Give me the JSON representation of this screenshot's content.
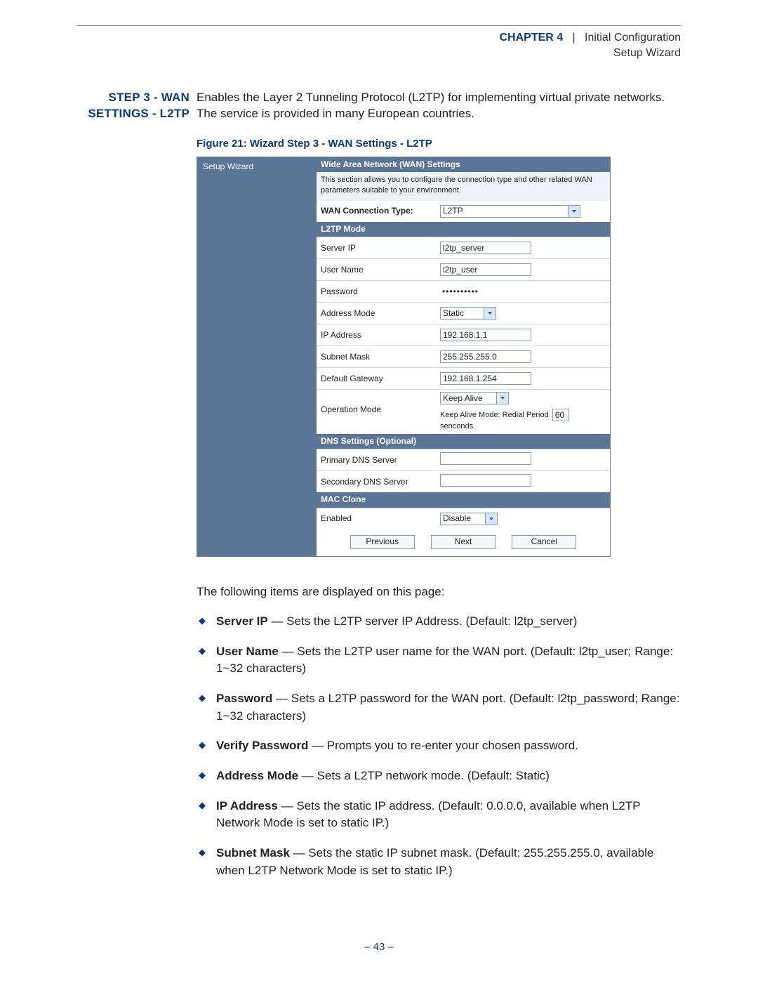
{
  "header": {
    "chapter_label": "CHAPTER",
    "chapter_no": "4",
    "separator": "|",
    "title": "Initial Configuration",
    "subtitle": "Setup Wizard"
  },
  "section": {
    "margin_title_line1": "STEP 3 - WAN",
    "margin_title_line2": "SETTINGS - L2TP",
    "intro": "Enables the Layer 2 Tunneling Protocol (L2TP) for implementing virtual private networks. The service is provided in many European countries."
  },
  "figure": {
    "caption": "Figure 21:  Wizard Step 3 - WAN Settings - L2TP",
    "sidebar_item": "Setup Wizard",
    "panel_title": "Wide Area Network (WAN) Settings",
    "panel_desc": "This section allows you to configure the connection type and other related WAN parameters suitable to your environment.",
    "conn_type_label": "WAN Connection Type:",
    "conn_type_value": "L2TP",
    "sections": {
      "l2tp_mode": "L2TP Mode",
      "dns": "DNS Settings (Optional)",
      "mac": "MAC Clone"
    },
    "rows": {
      "server_ip": {
        "label": "Server IP",
        "value": "l2tp_server"
      },
      "user_name": {
        "label": "User Name",
        "value": "l2tp_user"
      },
      "password": {
        "label": "Password",
        "value": "••••••••••"
      },
      "addr_mode": {
        "label": "Address Mode",
        "value": "Static"
      },
      "ip_address": {
        "label": "IP Address",
        "value": "192.168.1.1"
      },
      "subnet_mask": {
        "label": "Subnet Mask",
        "value": "255.255.255.0"
      },
      "gateway": {
        "label": "Default Gateway",
        "value": "192.168.1.254"
      },
      "op_mode": {
        "label": "Operation Mode",
        "value": "Keep Alive",
        "note_prefix": "Keep Alive Mode: Redial Period",
        "note_value": "60",
        "note_suffix": "senconds"
      },
      "pdns": {
        "label": "Primary DNS Server",
        "value": ""
      },
      "sdns": {
        "label": "Secondary DNS Server",
        "value": ""
      },
      "mac_enabled": {
        "label": "Enabled",
        "value": "Disable"
      }
    },
    "buttons": {
      "prev": "Previous",
      "next": "Next",
      "cancel": "Cancel"
    }
  },
  "after": {
    "lead": "The following items are displayed on this page:",
    "items": [
      {
        "term": "Server IP",
        "desc": " — Sets the L2TP server IP Address. (Default: l2tp_server)"
      },
      {
        "term": "User Name",
        "desc": " — Sets the L2TP user name for the WAN port. (Default: l2tp_user; Range: 1~32 characters)"
      },
      {
        "term": "Password",
        "desc": " — Sets a L2TP password for the WAN port. (Default: l2tp_password; Range: 1~32 characters)"
      },
      {
        "term": "Verify Password",
        "desc": " — Prompts you to re-enter your chosen password."
      },
      {
        "term": "Address Mode",
        "desc": " — Sets a L2TP network mode. (Default: Static)"
      },
      {
        "term": "IP Address",
        "desc": " — Sets the static IP address. (Default: 0.0.0.0, available when L2TP Network Mode is set to static IP.)"
      },
      {
        "term": "Subnet Mask",
        "desc": " — Sets the static IP subnet mask. (Default: 255.255.255.0, available when L2TP Network Mode is set to static IP.)"
      }
    ]
  },
  "page_number": "–  43  –"
}
